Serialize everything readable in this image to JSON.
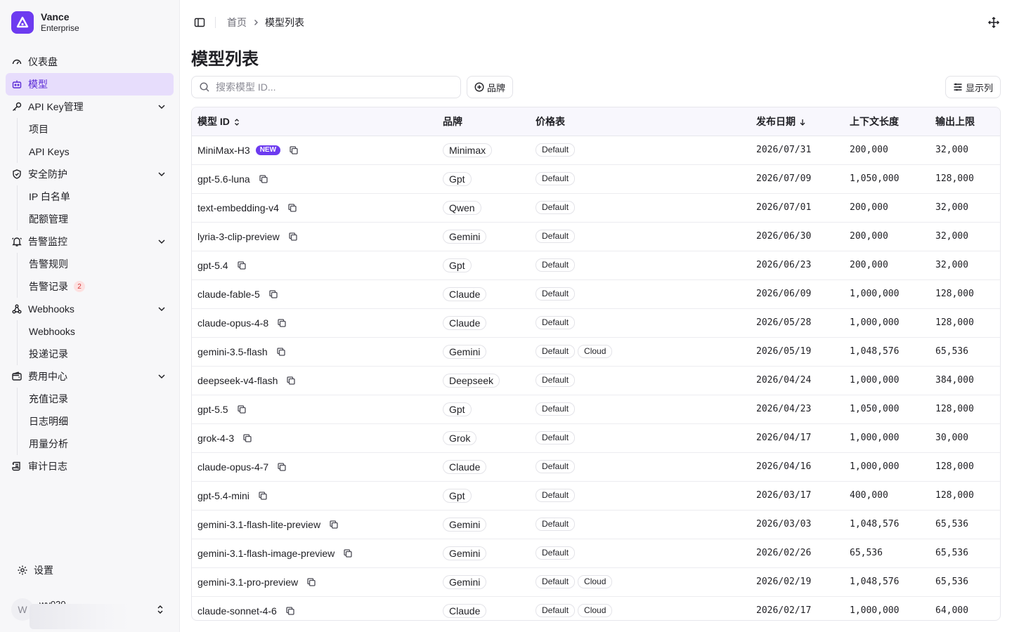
{
  "brand": {
    "name": "Vance",
    "sub": "Enterprise"
  },
  "sidebar": {
    "items": [
      {
        "label": "仪表盘",
        "icon": "gauge-icon"
      },
      {
        "label": "模型",
        "icon": "bot-icon",
        "active": true
      },
      {
        "label": "API Key管理",
        "icon": "key-icon",
        "children": [
          "项目",
          "API Keys"
        ]
      },
      {
        "label": "安全防护",
        "icon": "shield-icon",
        "children": [
          "IP 白名单",
          "配额管理"
        ]
      },
      {
        "label": "告警监控",
        "icon": "bell-icon",
        "children": [
          "告警规则",
          "告警记录"
        ]
      },
      {
        "label": "Webhooks",
        "icon": "webhook-icon",
        "children": [
          "Webhooks",
          "投递记录"
        ]
      },
      {
        "label": "费用中心",
        "icon": "wallet-icon",
        "children": [
          "充值记录",
          "日志明细",
          "用量分析"
        ]
      },
      {
        "label": "审计日志",
        "icon": "scroll-icon"
      }
    ],
    "alert_count": "2",
    "settings_label": "设置",
    "user": {
      "avatar": "W",
      "name": "wy030"
    }
  },
  "breadcrumb": {
    "home": "首页",
    "current": "模型列表"
  },
  "page_title": "模型列表",
  "search": {
    "placeholder": "搜索模型 ID..."
  },
  "toolbar": {
    "brand_filter": "品牌",
    "columns": "显示列"
  },
  "table": {
    "columns": [
      "模型 ID",
      "品牌",
      "价格表",
      "发布日期",
      "上下文长度",
      "输出上限"
    ],
    "new_label": "NEW",
    "rows": [
      {
        "id": "MiniMax-H3",
        "new": true,
        "brand": "Minimax",
        "prices": [
          "Default"
        ],
        "date": "2026/07/31",
        "ctx": "200,000",
        "out": "32,000"
      },
      {
        "id": "gpt-5.6-luna",
        "brand": "Gpt",
        "prices": [
          "Default"
        ],
        "date": "2026/07/09",
        "ctx": "1,050,000",
        "out": "128,000"
      },
      {
        "id": "text-embedding-v4",
        "brand": "Qwen",
        "prices": [
          "Default"
        ],
        "date": "2026/07/01",
        "ctx": "200,000",
        "out": "32,000"
      },
      {
        "id": "lyria-3-clip-preview",
        "brand": "Gemini",
        "prices": [
          "Default"
        ],
        "date": "2026/06/30",
        "ctx": "200,000",
        "out": "32,000"
      },
      {
        "id": "gpt-5.4",
        "brand": "Gpt",
        "prices": [
          "Default"
        ],
        "date": "2026/06/23",
        "ctx": "200,000",
        "out": "32,000"
      },
      {
        "id": "claude-fable-5",
        "brand": "Claude",
        "prices": [
          "Default"
        ],
        "date": "2026/06/09",
        "ctx": "1,000,000",
        "out": "128,000"
      },
      {
        "id": "claude-opus-4-8",
        "brand": "Claude",
        "prices": [
          "Default"
        ],
        "date": "2026/05/28",
        "ctx": "1,000,000",
        "out": "128,000"
      },
      {
        "id": "gemini-3.5-flash",
        "brand": "Gemini",
        "prices": [
          "Default",
          "Cloud"
        ],
        "date": "2026/05/19",
        "ctx": "1,048,576",
        "out": "65,536"
      },
      {
        "id": "deepseek-v4-flash",
        "brand": "Deepseek",
        "prices": [
          "Default"
        ],
        "date": "2026/04/24",
        "ctx": "1,000,000",
        "out": "384,000"
      },
      {
        "id": "gpt-5.5",
        "brand": "Gpt",
        "prices": [
          "Default"
        ],
        "date": "2026/04/23",
        "ctx": "1,050,000",
        "out": "128,000"
      },
      {
        "id": "grok-4-3",
        "brand": "Grok",
        "prices": [
          "Default"
        ],
        "date": "2026/04/17",
        "ctx": "1,000,000",
        "out": "30,000"
      },
      {
        "id": "claude-opus-4-7",
        "brand": "Claude",
        "prices": [
          "Default"
        ],
        "date": "2026/04/16",
        "ctx": "1,000,000",
        "out": "128,000"
      },
      {
        "id": "gpt-5.4-mini",
        "brand": "Gpt",
        "prices": [
          "Default"
        ],
        "date": "2026/03/17",
        "ctx": "400,000",
        "out": "128,000"
      },
      {
        "id": "gemini-3.1-flash-lite-preview",
        "brand": "Gemini",
        "prices": [
          "Default"
        ],
        "date": "2026/03/03",
        "ctx": "1,048,576",
        "out": "65,536"
      },
      {
        "id": "gemini-3.1-flash-image-preview",
        "brand": "Gemini",
        "prices": [
          "Default"
        ],
        "date": "2026/02/26",
        "ctx": "65,536",
        "out": "65,536"
      },
      {
        "id": "gemini-3.1-pro-preview",
        "brand": "Gemini",
        "prices": [
          "Default",
          "Cloud"
        ],
        "date": "2026/02/19",
        "ctx": "1,048,576",
        "out": "65,536"
      },
      {
        "id": "claude-sonnet-4-6",
        "brand": "Claude",
        "prices": [
          "Default",
          "Cloud"
        ],
        "date": "2026/02/17",
        "ctx": "1,000,000",
        "out": "64,000"
      }
    ]
  },
  "colors": {
    "accent": "#6d3bf0",
    "active_bg": "#e7ddfc"
  }
}
